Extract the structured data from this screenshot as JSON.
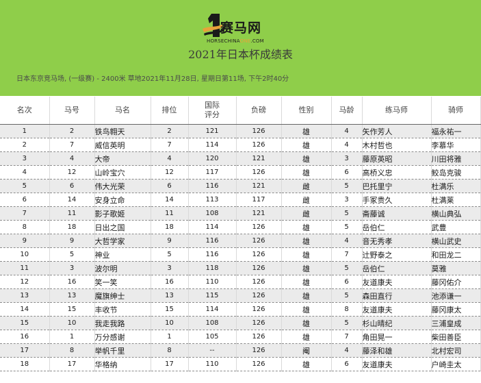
{
  "header": {
    "logo_text": "赛马网",
    "logo_sub_pre": "HORSECHINA",
    "logo_sub_accent": "ONE",
    "logo_sub_post": ".COM",
    "title": "2021年日本杯成绩表",
    "race_info": "日本东京竞马场, (一级赛) - 2400米 草地2021年11月28日, 星期日第11场, 下午2时40分"
  },
  "colors": {
    "header_bg": "#8fce4a",
    "row_alt": "#ebebeb",
    "logo_accent": "#e8a23a"
  },
  "table": {
    "columns": [
      "名次",
      "马号",
      "马名",
      "排位",
      "国际\n评分",
      "负磅",
      "性别",
      "马龄",
      "练马师",
      "骑师"
    ],
    "rows": [
      [
        "1",
        "2",
        "铁鸟翱天",
        "2",
        "121",
        "126",
        "雄",
        "4",
        "矢作芳人",
        "福永祐一"
      ],
      [
        "2",
        "7",
        "威信英明",
        "7",
        "114",
        "126",
        "雄",
        "4",
        "木村哲也",
        "李慕华"
      ],
      [
        "3",
        "4",
        "大帝",
        "4",
        "120",
        "121",
        "雄",
        "3",
        "藤原英昭",
        "川田将雅"
      ],
      [
        "4",
        "12",
        "山岭宝穴",
        "12",
        "117",
        "126",
        "雄",
        "6",
        "高桥义忠",
        "鲛岛克骏"
      ],
      [
        "5",
        "6",
        "伟大光荣",
        "6",
        "116",
        "121",
        "雌",
        "5",
        "巴托里宁",
        "杜满乐"
      ],
      [
        "6",
        "14",
        "安身立命",
        "14",
        "113",
        "117",
        "雌",
        "3",
        "手冢贵久",
        "杜满莱"
      ],
      [
        "7",
        "11",
        "影子歌姬",
        "11",
        "108",
        "121",
        "雌",
        "5",
        "斋藤诚",
        "横山典弘"
      ],
      [
        "8",
        "18",
        "日出之国",
        "18",
        "114",
        "126",
        "雄",
        "5",
        "岳伯仁",
        "武豊"
      ],
      [
        "9",
        "9",
        "大哲学家",
        "9",
        "116",
        "126",
        "雄",
        "4",
        "音无秀孝",
        "横山武史"
      ],
      [
        "10",
        "5",
        "神业",
        "5",
        "116",
        "126",
        "雄",
        "7",
        "辻野泰之",
        "和田龙二"
      ],
      [
        "11",
        "3",
        "波尔明",
        "3",
        "118",
        "126",
        "雄",
        "5",
        "岳伯仁",
        "莫雅"
      ],
      [
        "12",
        "16",
        "笑一笑",
        "16",
        "110",
        "126",
        "雄",
        "6",
        "友道康夫",
        "藤冈佑介"
      ],
      [
        "13",
        "13",
        "魔旗绅士",
        "13",
        "115",
        "126",
        "雄",
        "5",
        "森田直行",
        "池添谦一"
      ],
      [
        "14",
        "15",
        "丰收节",
        "15",
        "114",
        "126",
        "雄",
        "8",
        "友道康夫",
        "藤冈康太"
      ],
      [
        "15",
        "10",
        "我走我路",
        "10",
        "108",
        "126",
        "雄",
        "5",
        "杉山晴纪",
        "三浦皇成"
      ],
      [
        "16",
        "1",
        "万分感谢",
        "1",
        "105",
        "126",
        "雄",
        "7",
        "角田晃一",
        "柴田善臣"
      ],
      [
        "17",
        "8",
        "举帆千里",
        "8",
        "--",
        "126",
        "阉",
        "4",
        "藤泽和雄",
        "北村宏司"
      ],
      [
        "18",
        "17",
        "华格纳",
        "17",
        "110",
        "126",
        "雄",
        "6",
        "友道康夫",
        "户崎圭太"
      ]
    ]
  }
}
